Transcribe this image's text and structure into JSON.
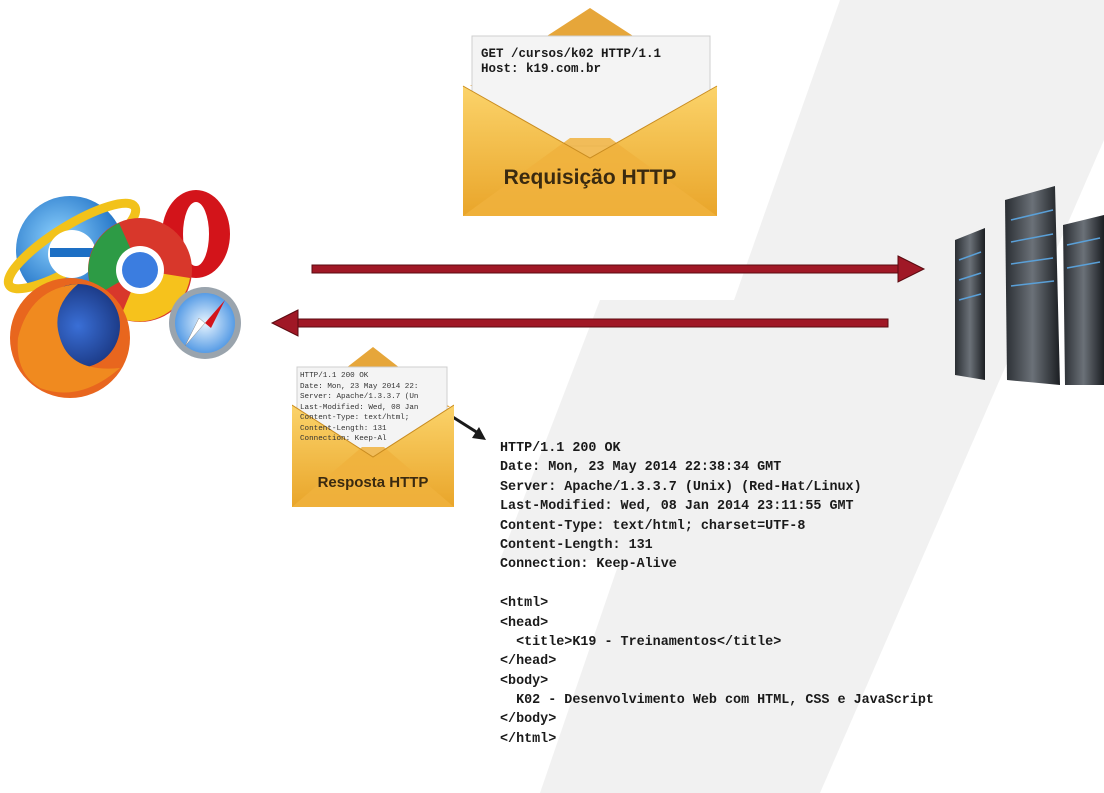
{
  "request": {
    "label": "Requisição HTTP",
    "lines": [
      "GET /cursos/k02 HTTP/1.1",
      "Host: k19.com.br"
    ]
  },
  "response": {
    "label": "Resposta HTTP",
    "preview_lines": [
      "HTTP/1.1 200 OK",
      "Date: Mon, 23 May 2014 22:",
      "Server: Apache/1.3.3.7 (Un",
      "Last-Modified: Wed, 08 Jan",
      "Content-Type: text/html;",
      "Content-Length: 131",
      "Connection: Keep-Al"
    ],
    "full_lines": [
      "HTTP/1.1 200 OK",
      "Date: Mon, 23 May 2014 22:38:34 GMT",
      "Server: Apache/1.3.3.7 (Unix) (Red-Hat/Linux)",
      "Last-Modified: Wed, 08 Jan 2014 23:11:55 GMT",
      "Content-Type: text/html; charset=UTF-8",
      "Content-Length: 131",
      "Connection: Keep-Alive",
      "",
      "<html>",
      "<head>",
      "  <title>K19 - Treinamentos</title>",
      "</head>",
      "<body>",
      "  K02 - Desenvolvimento Web com HTML, CSS e JavaScript",
      "</body>",
      "</html>"
    ]
  },
  "icons": {
    "browsers": "browser-logos-icon",
    "servers": "server-rack-icon",
    "watermark": "k19-watermark"
  },
  "colors": {
    "arrow": "#a01826",
    "envelope": "#f3b93a",
    "letter": "#f4f4f4",
    "watermark": "#f0f0f0"
  }
}
